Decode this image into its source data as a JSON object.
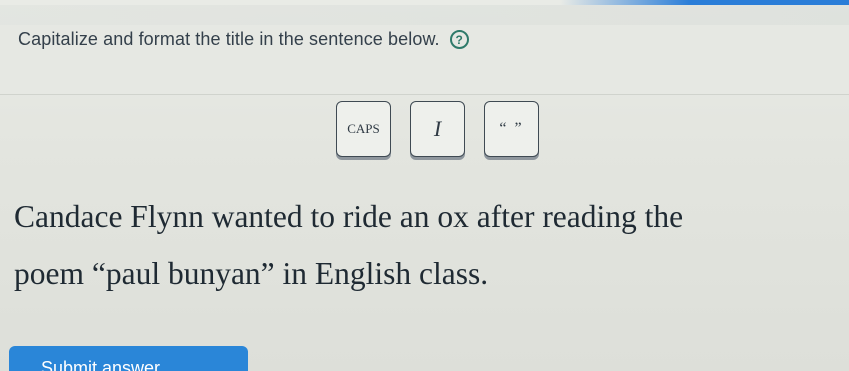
{
  "instruction": {
    "text": "Capitalize and format the title in the sentence below.",
    "help_icon": "question-mark-icon",
    "help_symbol": "?"
  },
  "toolbar": {
    "caps_label": "CAPS",
    "italic_label": "I",
    "quotes_label": "“ ”"
  },
  "sentence": {
    "line1": "Candace Flynn wanted to ride an ox after reading the",
    "line2": "poem “paul bunyan” in English class."
  },
  "submit": {
    "label": "Submit answer"
  },
  "colors": {
    "accent": "#2a86d8",
    "help_icon": "#2f7a6a",
    "background": "#e4e6e1"
  }
}
